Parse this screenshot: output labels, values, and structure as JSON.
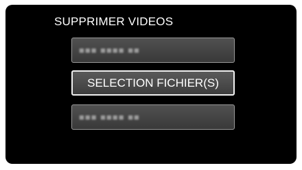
{
  "menu": {
    "title": "SUPPRIMER VIDEOS",
    "items": [
      {
        "label": "",
        "state": "placeholder"
      },
      {
        "label": "SELECTION FICHIER(S)",
        "state": "selected"
      },
      {
        "label": "",
        "state": "placeholder"
      }
    ]
  }
}
